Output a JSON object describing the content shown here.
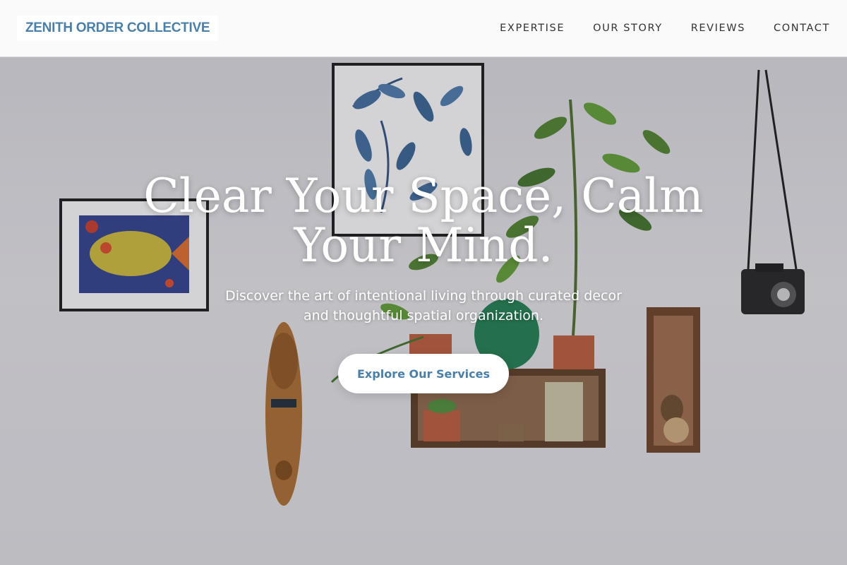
{
  "brand": {
    "name": "ZENITH ORDER COLLECTIVE",
    "color": "#4a7fa8"
  },
  "nav": {
    "items": [
      {
        "label": "EXPERTISE"
      },
      {
        "label": "OUR STORY"
      },
      {
        "label": "REVIEWS"
      },
      {
        "label": "CONTACT"
      }
    ]
  },
  "hero": {
    "headline": "Clear Your Space, Calm Your Mind.",
    "subtext": "Discover the art of intentional living through curated decor and thoughtful spatial organization.",
    "cta_label": "Explore Our Services"
  }
}
